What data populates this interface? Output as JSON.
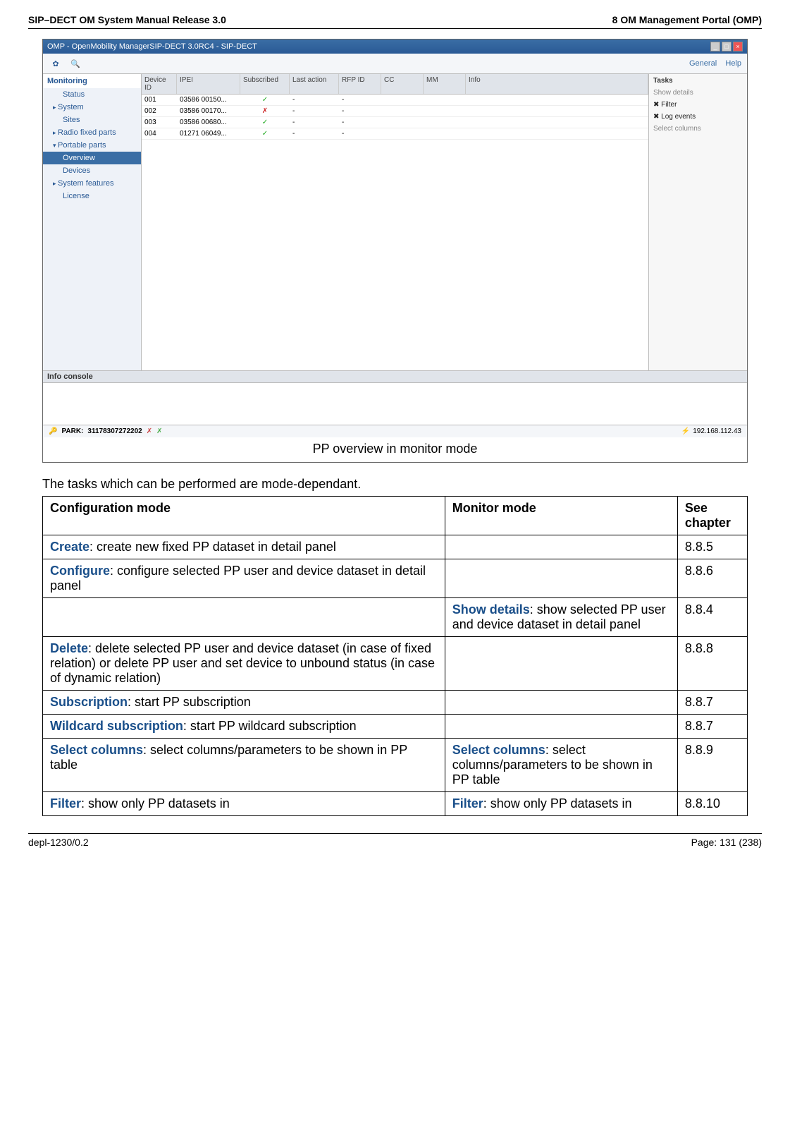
{
  "header": {
    "left": "SIP–DECT OM System Manual Release 3.0",
    "right": "8 OM Management Portal (OMP)"
  },
  "omp": {
    "title": "OMP - OpenMobility ManagerSIP-DECT 3.0RC4 - SIP-DECT",
    "menu_general": "General",
    "menu_help": "Help",
    "nav": {
      "monitoring": "Monitoring",
      "status": "Status",
      "system": "System",
      "sites": "Sites",
      "rfp": "Radio fixed parts",
      "pp": "Portable parts",
      "overview": "Overview",
      "devices": "Devices",
      "sysfeat": "System features",
      "license": "License"
    },
    "cols": {
      "device_id": "Device ID",
      "ipei": "IPEI",
      "subscribed": "Subscribed",
      "last_action": "Last action",
      "rfp_id": "RFP ID",
      "cc": "CC",
      "mm": "MM",
      "info": "Info"
    },
    "rows": [
      {
        "id": "001",
        "ipei": "03586 00150...",
        "sub": "✓",
        "la": "-",
        "rfp": "-"
      },
      {
        "id": "002",
        "ipei": "03586 00170...",
        "sub": "✗",
        "la": "-",
        "rfp": "-"
      },
      {
        "id": "003",
        "ipei": "03586 00680...",
        "sub": "✓",
        "la": "-",
        "rfp": "-"
      },
      {
        "id": "004",
        "ipei": "01271 06049...",
        "sub": "✓",
        "la": "-",
        "rfp": "-"
      }
    ],
    "tasks": {
      "header": "Tasks",
      "show_details": "Show details",
      "filter": "Filter",
      "log_events": "Log events",
      "select_columns": "Select columns"
    },
    "info_console": "Info console",
    "status_park_label": "PARK:",
    "status_park_value": "31178307272202",
    "status_ip": "192.168.112.43"
  },
  "caption": "PP overview in monitor mode",
  "tasks_intro": "The tasks which can be performed are mode-dependant.",
  "table": {
    "h1": "Configuration mode",
    "h2": "Monitor mode",
    "h3": "See chapter",
    "rows": [
      {
        "c1_term": "Create",
        "c1_rest": ": create new fixed PP dataset in detail panel",
        "c2_term": "",
        "c2_rest": "",
        "c3": "8.8.5"
      },
      {
        "c1_term": "Configure",
        "c1_rest": ": configure selected PP user and device dataset in detail panel",
        "c2_term": "",
        "c2_rest": "",
        "c3": "8.8.6"
      },
      {
        "c1_term": "",
        "c1_rest": "",
        "c2_term": "Show details",
        "c2_rest": ": show selected PP user and device dataset in detail panel",
        "c3": "8.8.4"
      },
      {
        "c1_term": "Delete",
        "c1_rest": ": delete selected PP user and device dataset (in case of fixed relation) or delete PP user and set device to unbound status (in case of dynamic relation)",
        "c2_term": "",
        "c2_rest": "",
        "c3": "8.8.8"
      },
      {
        "c1_term": "Subscription",
        "c1_rest": ": start PP subscription",
        "c2_term": "",
        "c2_rest": "",
        "c3": "8.8.7"
      },
      {
        "c1_term": "Wildcard subscription",
        "c1_rest": ": start PP wildcard subscription",
        "c2_term": "",
        "c2_rest": "",
        "c3": "8.8.7"
      },
      {
        "c1_term": "Select columns",
        "c1_rest": ": select columns/parameters to be shown in PP table",
        "c2_term": "Select columns",
        "c2_rest": ": select columns/parameters to be shown in PP table",
        "c3": "8.8.9"
      },
      {
        "c1_term": "Filter",
        "c1_rest": ": show only PP datasets in",
        "c2_term": "Filter",
        "c2_rest": ": show only PP datasets in",
        "c3": "8.8.10"
      }
    ]
  },
  "footer": {
    "left": "depl-1230/0.2",
    "right": "Page: 131 (238)"
  }
}
